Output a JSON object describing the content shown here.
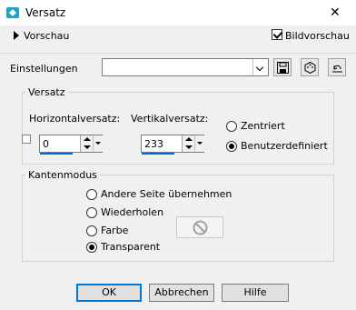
{
  "window": {
    "title": "Versatz",
    "icon": "app-icon",
    "close_glyph": "✕"
  },
  "preview": {
    "label": "Vorschau",
    "checkbox_label": "Bildvorschau",
    "checked": true
  },
  "settings": {
    "label": "Einstellungen",
    "preset_value": "",
    "buttons": [
      "save-icon",
      "dice-icon",
      "reset-icon"
    ]
  },
  "offset_group": {
    "title": "Versatz",
    "horizontal_label": "Horizontalversatz:",
    "horizontal_value": "0",
    "vertical_label": "Vertikalversatz:",
    "vertical_value": "233",
    "radio_centered": "Zentriert",
    "radio_custom": "Benutzerdefiniert",
    "selected": "Benutzerdefiniert",
    "link_checked": false
  },
  "edge_group": {
    "title": "Kantenmodus",
    "options": [
      "Andere Seite übernehmen",
      "Wiederholen",
      "Farbe",
      "Transparent"
    ],
    "selected": "Transparent"
  },
  "footer": {
    "ok": "OK",
    "cancel": "Abbrechen",
    "help": "Hilfe"
  }
}
